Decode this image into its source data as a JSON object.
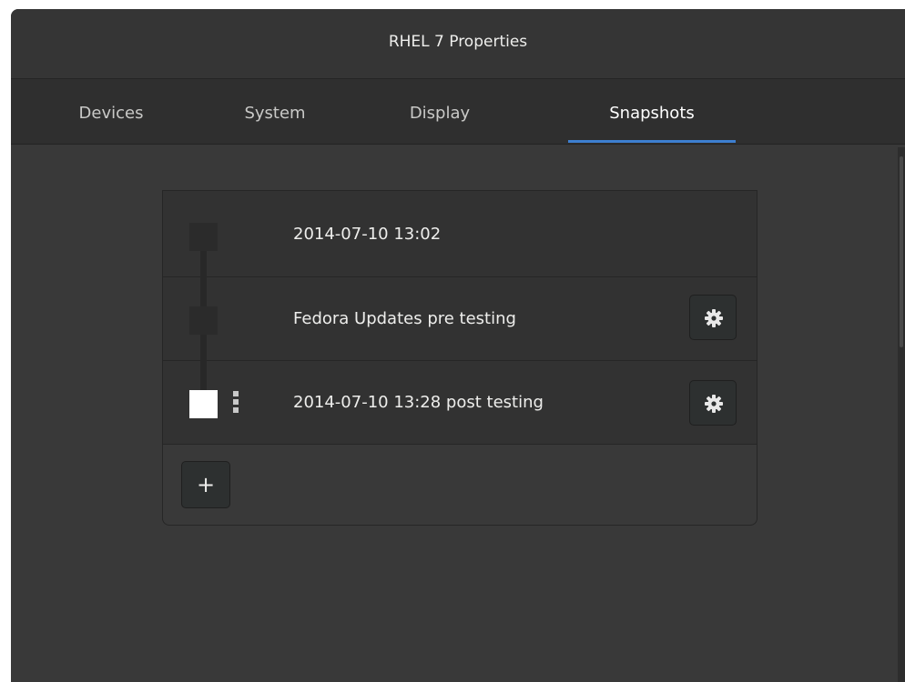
{
  "window": {
    "title": "RHEL 7 Properties"
  },
  "tabs": [
    {
      "label": "Devices",
      "active": false
    },
    {
      "label": "System",
      "active": false
    },
    {
      "label": "Display",
      "active": false
    },
    {
      "label": "Snapshots",
      "active": true
    }
  ],
  "snapshots": [
    {
      "name": "2014-07-10 13:02",
      "current": false,
      "has_settings": false
    },
    {
      "name": "Fedora Updates pre testing",
      "current": false,
      "has_settings": true
    },
    {
      "name": "2014-07-10 13:28 post testing",
      "current": true,
      "has_settings": true
    }
  ],
  "add_button": {
    "label": "+"
  },
  "icons": {
    "settings": "gear-icon",
    "current_marker": "kebab-dots-icon",
    "add": "plus-icon"
  },
  "colors": {
    "accent": "#3d7fd0",
    "background": "#393939",
    "current_node": "#ffffff"
  }
}
